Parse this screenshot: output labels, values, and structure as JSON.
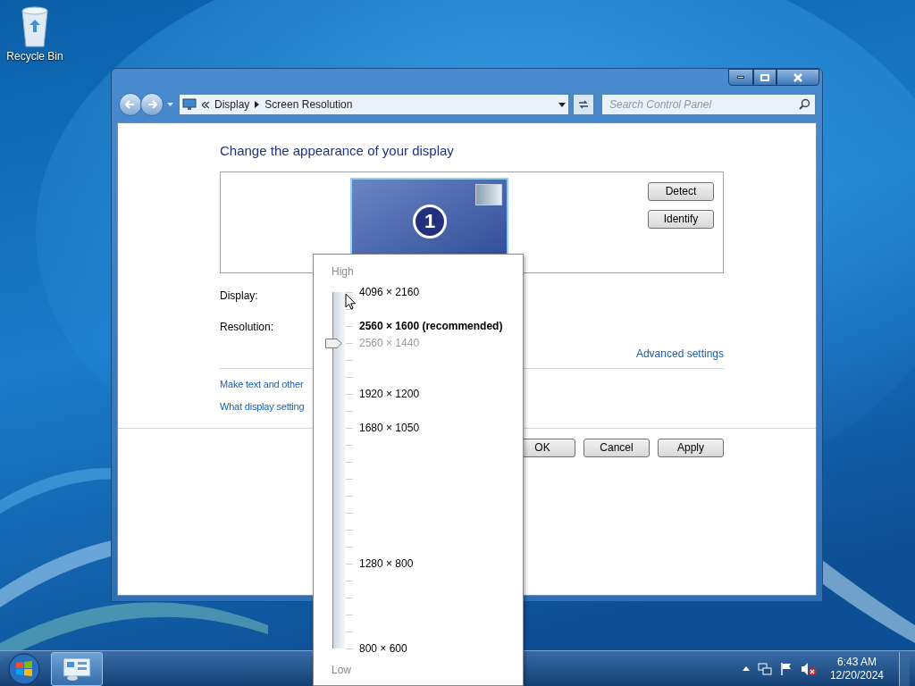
{
  "desktop": {
    "icons": [
      {
        "label": "Recycle Bin"
      }
    ]
  },
  "window": {
    "breadcrumb": [
      "Display",
      "Screen Resolution"
    ],
    "search": {
      "placeholder": "Search Control Panel"
    }
  },
  "heading": "Change the appearance of your display",
  "monitor": {
    "number": "1"
  },
  "side_buttons": [
    "Detect",
    "Identify"
  ],
  "fields": [
    {
      "label": "Display:"
    },
    {
      "label": "Resolution:"
    }
  ],
  "advanced_link": "Advanced settings",
  "links": [
    "Make text and other",
    "What display setting"
  ],
  "buttons": [
    "OK",
    "Cancel",
    "Apply"
  ],
  "resolution_popup": {
    "high_label": "High",
    "low_label": "Low",
    "level": 0.857,
    "options": [
      {
        "label": "4096 × 2160",
        "kind": "normal"
      },
      {
        "label": "2560 × 1600 (recommended)",
        "kind": "bold"
      },
      {
        "label": "2560 × 1440",
        "kind": "dim"
      },
      {
        "label": "1920 × 1200",
        "kind": "normal"
      },
      {
        "label": "1680 × 1050",
        "kind": "normal"
      },
      {
        "label": "1280 × 800",
        "kind": "normal"
      },
      {
        "label": "800 × 600",
        "kind": "normal"
      }
    ]
  },
  "taskbar": {
    "time": "6:43 AM",
    "date": "12/20/2024"
  }
}
